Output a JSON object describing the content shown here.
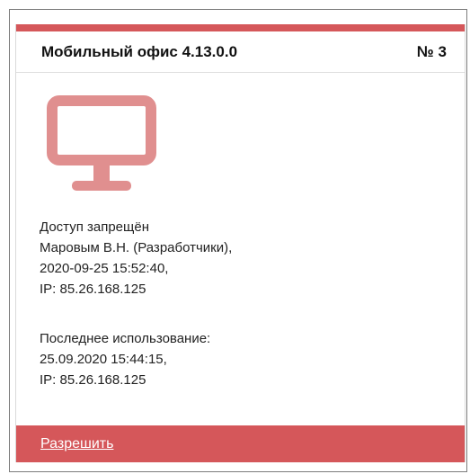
{
  "card": {
    "title": "Мобильный офис 4.13.0.0",
    "number": "№ 3",
    "icon": "monitor-icon",
    "accent_color": "#d5575a",
    "icon_color": "#e08f8f",
    "access": {
      "line1": "Доступ запрещён",
      "line2": "Маровым В.Н. (Разработчики),",
      "line3": "2020-09-25 15:52:40,",
      "line4": "IP: 85.26.168.125"
    },
    "last_use": {
      "line1": "Последнее использование:",
      "line2": "25.09.2020 15:44:15,",
      "line3": "IP: 85.26.168.125"
    },
    "footer": {
      "allow_label": "Разрешить"
    }
  }
}
